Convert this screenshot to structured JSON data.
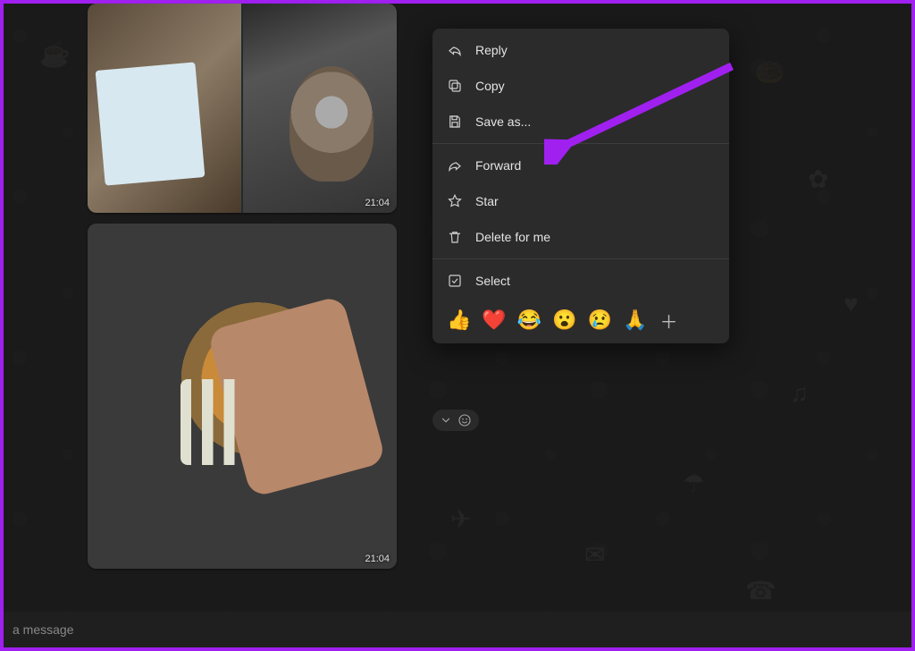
{
  "messages": [
    {
      "timestamp": "21:04"
    },
    {
      "timestamp": "21:04"
    }
  ],
  "contextMenu": {
    "items": [
      {
        "icon": "reply",
        "label": "Reply"
      },
      {
        "icon": "copy",
        "label": "Copy"
      },
      {
        "icon": "save",
        "label": "Save as..."
      },
      {
        "icon": "forward",
        "label": "Forward"
      },
      {
        "icon": "star",
        "label": "Star"
      },
      {
        "icon": "delete",
        "label": "Delete for me"
      },
      {
        "icon": "select",
        "label": "Select"
      }
    ],
    "reactions": [
      "👍",
      "❤️",
      "😂",
      "😮",
      "😢",
      "🙏"
    ]
  },
  "inputBar": {
    "placeholder": "a message"
  }
}
